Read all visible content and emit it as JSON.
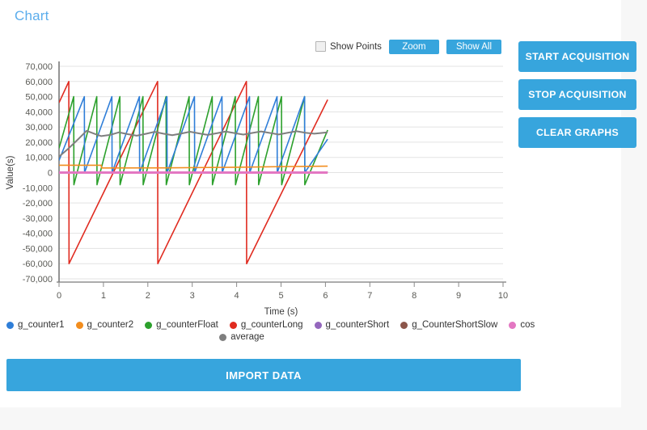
{
  "page": {
    "title": "Chart",
    "accent_color": "#37a5dd",
    "title_color": "#5badec",
    "card_background": "#ffffff",
    "page_background": "#f7f7f7"
  },
  "toolbar": {
    "show_points_label": "Show Points",
    "show_points_checked": false,
    "zoom_label": "Zoom",
    "show_all_label": "Show All"
  },
  "actions": {
    "start_label": "START ACQUISITION",
    "stop_label": "STOP ACQUISITION",
    "clear_label": "CLEAR GRAPHS"
  },
  "footer": {
    "import_label": "IMPORT DATA"
  },
  "chart_data": {
    "type": "line",
    "title": "",
    "xlabel": "Time (s)",
    "ylabel": "Value(s)",
    "xlim": [
      0,
      10
    ],
    "ylim": [
      -70000,
      70000
    ],
    "xticks": [
      0,
      1,
      2,
      3,
      4,
      5,
      6,
      7,
      8,
      9,
      10
    ],
    "ytick_labels": [
      "70,000",
      "60,000",
      "50,000",
      "40,000",
      "30,000",
      "20,000",
      "10,000",
      "0",
      "-10,000",
      "-20,000",
      "-30,000",
      "-40,000",
      "-50,000",
      "-60,000",
      "-70,000"
    ],
    "yticks": [
      70000,
      60000,
      50000,
      40000,
      30000,
      20000,
      10000,
      0,
      -10000,
      -20000,
      -30000,
      -40000,
      -50000,
      -60000,
      -70000
    ],
    "grid": true,
    "grid_color": "#e3e3e3",
    "legend_position": "bottom",
    "data_x_end": 6.05,
    "series": [
      {
        "name": "g_counter1",
        "color": "#2f7ed8",
        "waveform": "sawtooth",
        "period": 0.62,
        "phase": 0.05,
        "min": 0,
        "max": 50000,
        "points": [
          [
            0.0,
            8000
          ],
          [
            0.57,
            50000
          ],
          [
            0.575,
            0
          ],
          [
            1.19,
            50000
          ],
          [
            1.195,
            0
          ],
          [
            1.81,
            50000
          ],
          [
            1.815,
            0
          ],
          [
            2.43,
            50000
          ],
          [
            2.435,
            0
          ],
          [
            3.05,
            50000
          ],
          [
            3.055,
            0
          ],
          [
            3.67,
            50000
          ],
          [
            3.675,
            0
          ],
          [
            4.29,
            50000
          ],
          [
            4.295,
            0
          ],
          [
            4.91,
            50000
          ],
          [
            4.915,
            0
          ],
          [
            5.53,
            50000
          ],
          [
            5.535,
            0
          ],
          [
            6.05,
            22000
          ]
        ]
      },
      {
        "name": "g_counter2",
        "color": "#f28d1e",
        "waveform": "near-flat",
        "min": 2000,
        "max": 5000,
        "points": [
          [
            0.0,
            4800
          ],
          [
            0.95,
            4800
          ],
          [
            0.96,
            3000
          ],
          [
            2.4,
            3100
          ],
          [
            4.0,
            3500
          ],
          [
            5.2,
            4000
          ],
          [
            6.05,
            4200
          ]
        ]
      },
      {
        "name": "g_counterFloat",
        "color": "#2ca02c",
        "waveform": "sawtooth",
        "period": 0.52,
        "phase": 0.0,
        "min": -8000,
        "max": 50000,
        "points": [
          [
            0.0,
            16000
          ],
          [
            0.33,
            50000
          ],
          [
            0.335,
            -8000
          ],
          [
            0.85,
            50000
          ],
          [
            0.855,
            -8000
          ],
          [
            1.37,
            50000
          ],
          [
            1.375,
            -8000
          ],
          [
            1.89,
            50000
          ],
          [
            1.895,
            -8000
          ],
          [
            2.41,
            50000
          ],
          [
            2.415,
            -8000
          ],
          [
            2.93,
            50000
          ],
          [
            2.935,
            -8000
          ],
          [
            3.45,
            50000
          ],
          [
            3.455,
            -8000
          ],
          [
            3.97,
            50000
          ],
          [
            3.975,
            -8000
          ],
          [
            4.49,
            50000
          ],
          [
            4.495,
            -8000
          ],
          [
            5.01,
            50000
          ],
          [
            5.015,
            -8000
          ],
          [
            5.53,
            50000
          ],
          [
            5.535,
            -8000
          ],
          [
            6.05,
            28000
          ]
        ]
      },
      {
        "name": "g_counterLong",
        "color": "#e02b20",
        "waveform": "sawtooth",
        "period": 2.0,
        "phase": 0.22,
        "min": -60000,
        "max": 60000,
        "points": [
          [
            0.0,
            46000
          ],
          [
            0.22,
            60000
          ],
          [
            0.225,
            -60000
          ],
          [
            2.22,
            60000
          ],
          [
            2.225,
            -60000
          ],
          [
            4.22,
            60000
          ],
          [
            4.225,
            -60000
          ],
          [
            6.05,
            48000
          ]
        ]
      },
      {
        "name": "g_counterShort",
        "color": "#9467bd",
        "waveform": "flat",
        "min": 0,
        "max": 600,
        "points": [
          [
            0.0,
            400
          ],
          [
            6.05,
            400
          ]
        ]
      },
      {
        "name": "g_CounterShortSlow",
        "color": "#8c564b",
        "waveform": "flat",
        "min": 0,
        "max": 400,
        "points": [
          [
            0.0,
            250
          ],
          [
            6.05,
            250
          ]
        ]
      },
      {
        "name": "cos",
        "color": "#e377c2",
        "waveform": "cosine-flat",
        "min": -900,
        "max": 900,
        "points": [
          [
            0.0,
            0
          ],
          [
            6.05,
            0
          ]
        ]
      },
      {
        "name": "average",
        "color": "#7f7f7f",
        "waveform": "oscillating-mean",
        "min": 10000,
        "max": 28500,
        "points": [
          [
            0.0,
            10500
          ],
          [
            0.2,
            15500
          ],
          [
            0.45,
            22500
          ],
          [
            0.62,
            27500
          ],
          [
            0.8,
            25500
          ],
          [
            0.95,
            24000
          ],
          [
            1.15,
            24800
          ],
          [
            1.35,
            26500
          ],
          [
            1.55,
            25300
          ],
          [
            1.75,
            24300
          ],
          [
            1.95,
            25500
          ],
          [
            2.15,
            26800
          ],
          [
            2.35,
            25600
          ],
          [
            2.55,
            24600
          ],
          [
            2.75,
            25700
          ],
          [
            2.95,
            26900
          ],
          [
            3.15,
            25800
          ],
          [
            3.35,
            24800
          ],
          [
            3.55,
            25900
          ],
          [
            3.75,
            27000
          ],
          [
            3.95,
            26000
          ],
          [
            4.15,
            25000
          ],
          [
            4.35,
            26100
          ],
          [
            4.55,
            27100
          ],
          [
            4.75,
            26100
          ],
          [
            4.95,
            25100
          ],
          [
            5.15,
            26200
          ],
          [
            5.35,
            27200
          ],
          [
            5.55,
            26200
          ],
          [
            5.75,
            25600
          ],
          [
            6.05,
            26500
          ]
        ]
      }
    ]
  }
}
